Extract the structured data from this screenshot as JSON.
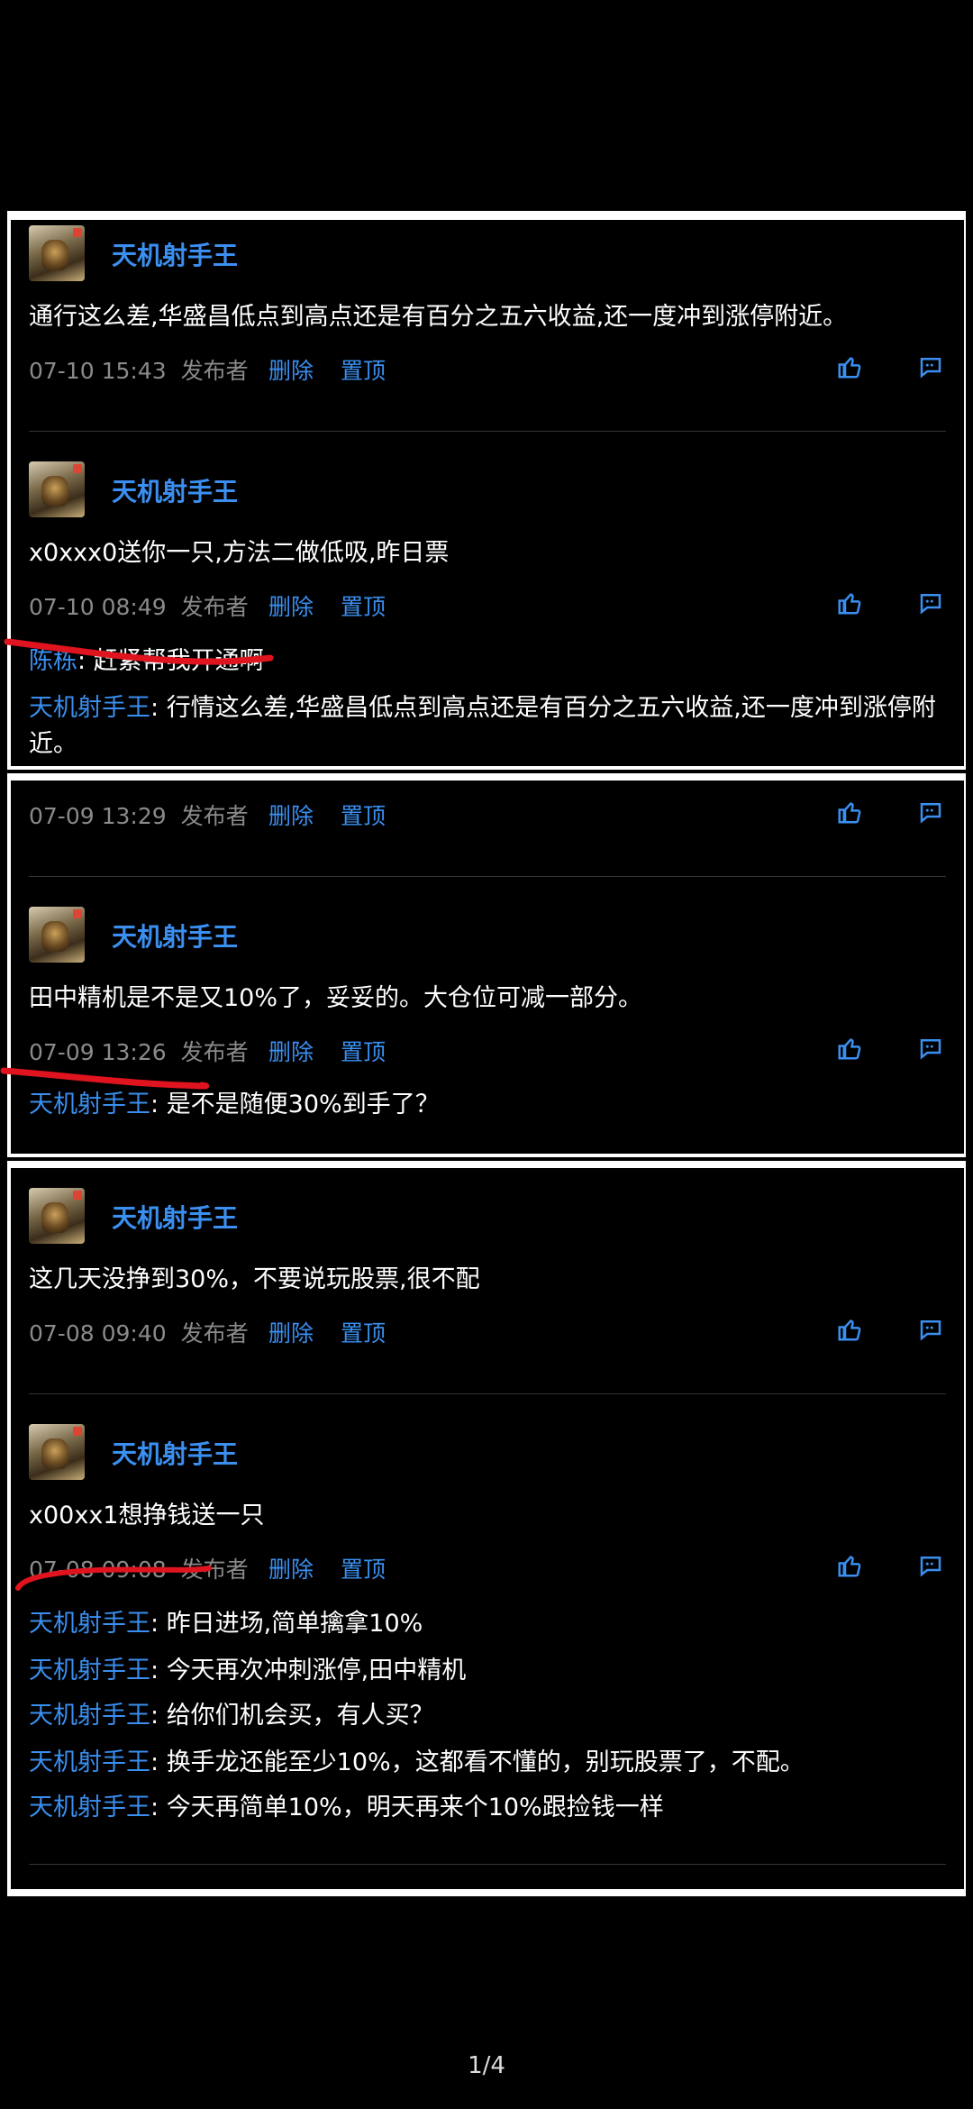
{
  "user": "天机射手王",
  "labels": {
    "publisher": "发布者",
    "delete": "删除",
    "pin": "置顶"
  },
  "posts": [
    {
      "text": "通行这么差,华盛昌低点到高点还是有百分之五六收益,还一度冲到涨停附近。",
      "time": "07-10 15:43"
    },
    {
      "text": "x0xxx0送你一只,方法二做低吸,昨日票",
      "time": "07-10 08:49",
      "replies": [
        {
          "who": "陈栋",
          "sep": ": ",
          "text": "赶紧帮我开通啊"
        },
        {
          "who": "天机射手王",
          "sep": ": ",
          "text": "行情这么差,华盛昌低点到高点还是有百分之五六收益,还一度冲到涨停附近。"
        }
      ]
    },
    {
      "time": "07-09 13:29"
    },
    {
      "text": "田中精机是不是又10%了，妥妥的。大仓位可减一部分。",
      "time": "07-09 13:26",
      "replies": [
        {
          "who": "天机射手王",
          "sep": ": ",
          "text": "是不是随便30%到手了？"
        }
      ]
    },
    {
      "text": "这几天没挣到30%，不要说玩股票,很不配",
      "time": "07-08 09:40"
    },
    {
      "text": "x00xx1想挣钱送一只",
      "time": "07-08 09:08",
      "replies": [
        {
          "who": "天机射手王",
          "sep": ": ",
          "text": "昨日进场,简单擒拿10%"
        },
        {
          "who": "天机射手王",
          "sep": ": ",
          "text": "今天再次冲刺涨停,田中精机"
        },
        {
          "who": "天机射手王",
          "sep": ": ",
          "text": "给你们机会买，有人买？"
        },
        {
          "who": "天机射手王",
          "sep": ": ",
          "text": "换手龙还能至少10%，这都看不懂的，别玩股票了，不配。"
        },
        {
          "who": "天机射手王",
          "sep": ": ",
          "text": "今天再简单10%，明天再来个10%跟捡钱一样"
        }
      ]
    }
  ],
  "pager": "1/4",
  "colors": {
    "accent": "#3a8ff0",
    "meta": "#8a8a8a",
    "annotation": "#e0141e"
  }
}
